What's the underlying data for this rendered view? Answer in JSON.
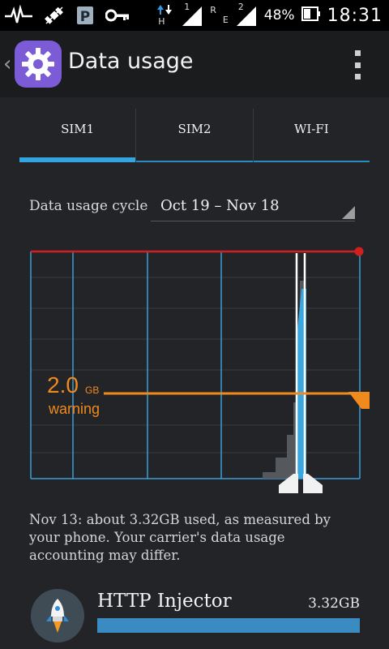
{
  "status_bar": {
    "net_type_1": "H",
    "net_type_2": "E",
    "roaming": "R",
    "sim_1_marker": "1",
    "sim_2_marker": "2",
    "battery": "48%",
    "time": "18:31",
    "icons": [
      "pulse-icon",
      "satellite-icon",
      "parking-icon",
      "key-icon",
      "data-arrows-icon",
      "signal-sim1-icon",
      "signal-sim2-icon",
      "battery-icon"
    ]
  },
  "action_bar": {
    "title": "Data usage",
    "icon": "gear-icon",
    "overflow_icon": "overflow-menu-icon"
  },
  "tabs": [
    {
      "label": "SIM1",
      "selected": true
    },
    {
      "label": "SIM2",
      "selected": false
    },
    {
      "label": "WI-FI",
      "selected": false
    }
  ],
  "cycle": {
    "label": "Data usage cycle",
    "value": "Oct 19 – Nov 18"
  },
  "chart": {
    "warning_value": "2.0",
    "warning_unit": "GB",
    "warning_label": "warning",
    "colors": {
      "limit": "#d11f1f",
      "warning": "#f08a1c",
      "grid": "#3a9fd5",
      "usage": "#3aa8e0"
    }
  },
  "caption": "Nov 13: about 3.32GB used, as measured by your phone. Your carrier's data usage accounting may differ.",
  "apps": [
    {
      "name": "HTTP Injector",
      "size": "3.32GB",
      "usage_fraction": 1.0,
      "icon": "rocket-icon"
    }
  ]
}
